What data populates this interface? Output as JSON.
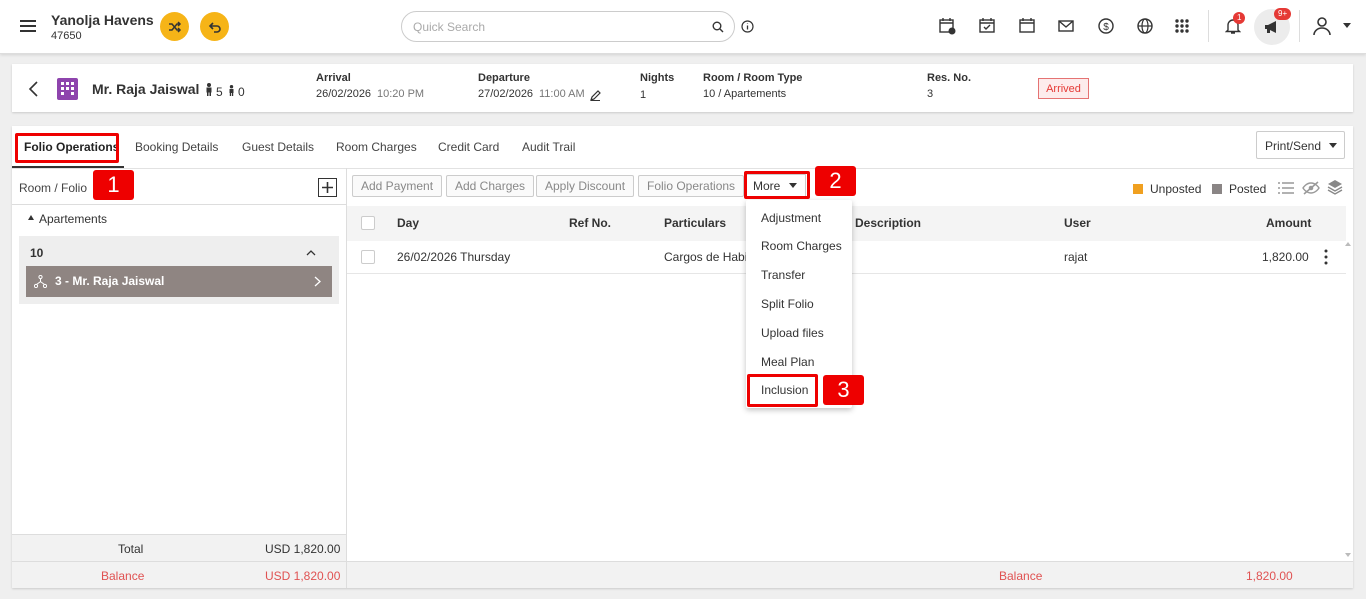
{
  "app": {
    "hotel_name": "Yanolja Havens",
    "hotel_id": "47650"
  },
  "topbar": {
    "search_placeholder": "Quick Search",
    "notification_count": "1",
    "announce_count": "9+"
  },
  "guest": {
    "name": "Mr. Raja Jaiswal",
    "adults": "5",
    "children": "0",
    "arrival_label": "Arrival",
    "arrival_date": "26/02/2026",
    "arrival_time": "10:20 PM",
    "departure_label": "Departure",
    "departure_date": "27/02/2026",
    "departure_time": "11:00 AM",
    "nights_label": "Nights",
    "nights": "1",
    "room_label": "Room / Room Type",
    "room": "10 / Apartements",
    "res_label": "Res. No.",
    "res_no": "3",
    "status": "Arrived"
  },
  "tabs": [
    "Folio Operations",
    "Booking Details",
    "Guest Details",
    "Room Charges",
    "Credit Card",
    "Audit Trail"
  ],
  "print_send": "Print/Send",
  "left_panel": {
    "header": "Room / Folio",
    "group": "Apartements",
    "room": "10",
    "folio": "3 - Mr. Raja Jaiswal",
    "total_label": "Total",
    "total_value": "USD 1,820.00",
    "balance_label": "Balance",
    "balance_value": "USD 1,820.00"
  },
  "actions": [
    "Add Payment",
    "Add Charges",
    "Apply Discount",
    "Folio Operations",
    "More"
  ],
  "legend": {
    "unposted": "Unposted",
    "posted": "Posted"
  },
  "table": {
    "headers": [
      "Day",
      "Ref No.",
      "Particulars",
      "Description",
      "User",
      "Amount"
    ],
    "rows": [
      {
        "day": "26/02/2026 Thursday",
        "ref": "",
        "particulars": "Cargos de Habit",
        "description": "",
        "user": "rajat",
        "amount": "1,820.00"
      }
    ],
    "balance_label": "Balance",
    "balance_value": "1,820.00"
  },
  "more_menu": [
    "Adjustment",
    "Room Charges",
    "Transfer",
    "Split Folio",
    "Upload files",
    "Meal Plan",
    "Inclusion"
  ],
  "annotations": [
    "1",
    "2",
    "3"
  ],
  "colors": {
    "accent": "#f6b417",
    "annotation": "#e00000",
    "unposted": "#f0a020",
    "posted": "#8a8585",
    "folio_row": "#8f8582",
    "balance": "#e05252"
  }
}
